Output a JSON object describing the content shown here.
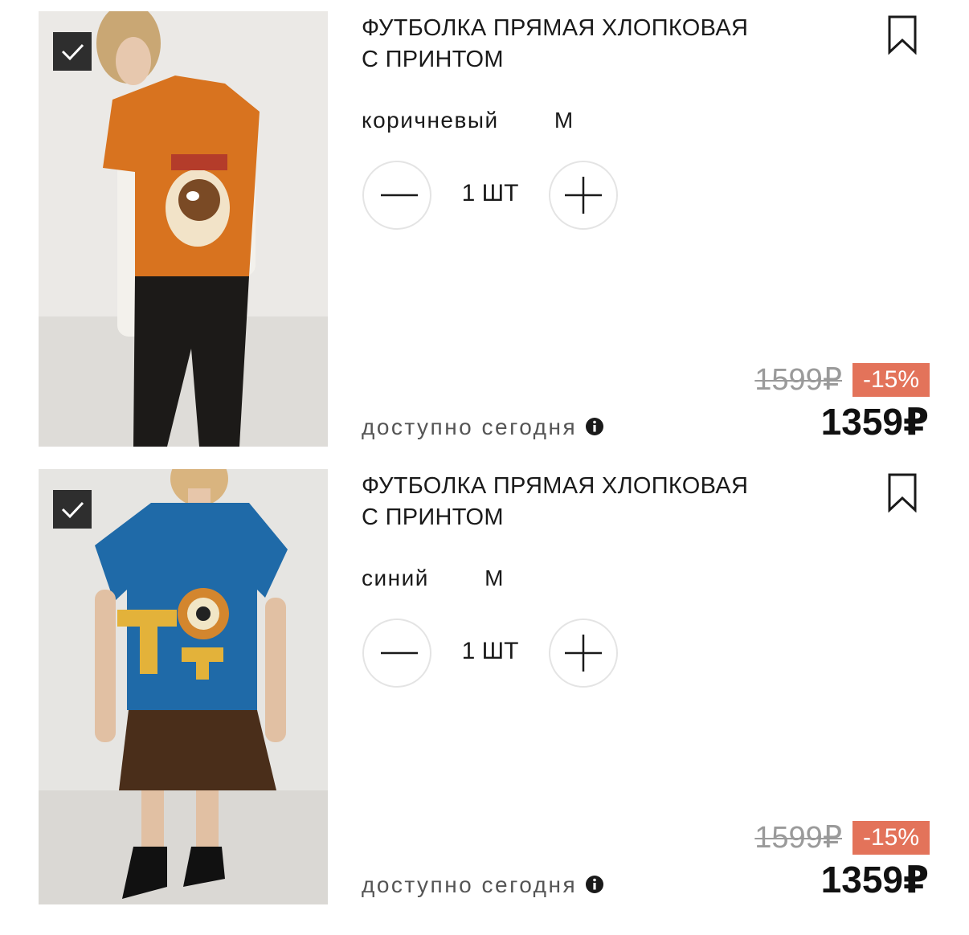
{
  "items": [
    {
      "title_line1": "ФУТБОЛКА ПРЯМАЯ ХЛОПКОВАЯ",
      "title_line2": "С ПРИНТОМ",
      "color": "коричневый",
      "size": "M",
      "quantity": "1 ШТ",
      "availability": "доступно сегодня",
      "old_price": "1599₽",
      "discount": "-15%",
      "price": "1359₽",
      "selected": true,
      "shirt_color": "#d8731f"
    },
    {
      "title_line1": "ФУТБОЛКА ПРЯМАЯ ХЛОПКОВАЯ",
      "title_line2": "С ПРИНТОМ",
      "color": "синий",
      "size": "M",
      "quantity": "1 ШТ",
      "availability": "доступно сегодня",
      "old_price": "1599₽",
      "discount": "-15%",
      "price": "1359₽",
      "selected": true,
      "shirt_color": "#1f6aa8"
    }
  ],
  "icons": {
    "checkbox": "checkmark-icon",
    "bookmark": "bookmark-icon",
    "minus": "minus-icon",
    "plus": "plus-icon",
    "info": "info-icon"
  },
  "colors": {
    "discount_badge": "#e3735a",
    "checkbox_bg": "#2e2e2e",
    "old_price": "#9a9a9a"
  }
}
